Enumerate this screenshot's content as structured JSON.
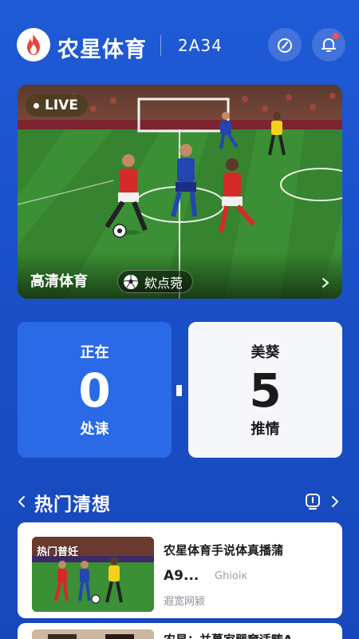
{
  "header": {
    "app_title": "农星体育",
    "code": "2A34"
  },
  "live": {
    "badge": "LIVE",
    "caption": "高清体育",
    "pill_label": "欸点菀"
  },
  "stats": {
    "left": {
      "top": "正在",
      "value": "0",
      "bottom": "处诔"
    },
    "right": {
      "top": "美葵",
      "value": "5",
      "bottom": "推情"
    }
  },
  "section": {
    "title": "热门清想"
  },
  "news": [
    {
      "thumb_tag": "热门普妊",
      "title": "农星体育手说体真播蒲",
      "meta1": "A9...",
      "meta2": "Ghioiκ",
      "sub": "遐宽网颍"
    },
    {
      "title": "农星：并蔓家罂奝适畴A"
    }
  ],
  "colors": {
    "background": "#1f5bd6",
    "stat_left": "#2a6ae6",
    "stat_right": "#f6f7fa",
    "logo_flame": "#e8453c",
    "notif": "#ff4d4f"
  }
}
